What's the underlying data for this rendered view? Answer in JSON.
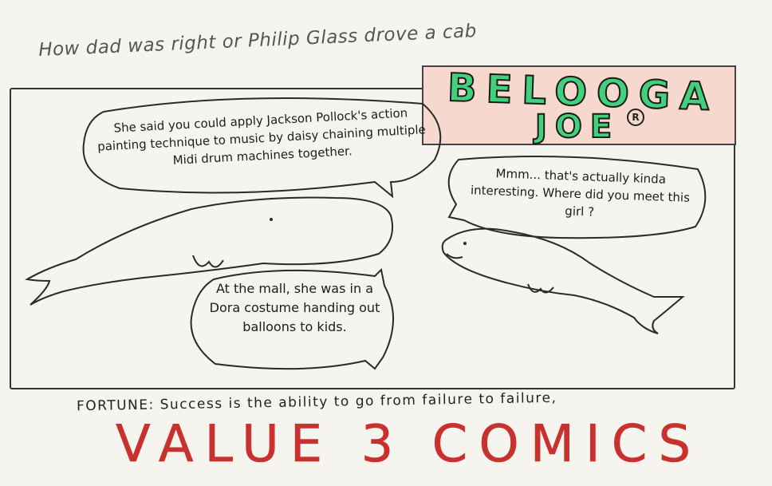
{
  "comic": {
    "title": "How dad was right or Philip Glass drove a cab",
    "logo": {
      "line1": "BELOOGA",
      "line2": "JOE",
      "registered_mark": "R"
    },
    "bubbles": {
      "top_left": "She said you could apply Jackson Pollock's action painting technique to music by daisy chaining multiple Midi drum machines together.",
      "right": "Mmm... that's actually kinda interesting. Where did you meet this girl ?",
      "bottom": "At the mall, she was in a Dora costume handing out balloons to kids."
    },
    "fortune": "FORTUNE: Success is the ability to go from failure to failure,",
    "footer": "VALUE 3 COMICS",
    "colors": {
      "logo_fill": "#43d07a",
      "logo_box": "#f6d8cf",
      "footer": "#c9312e"
    }
  }
}
